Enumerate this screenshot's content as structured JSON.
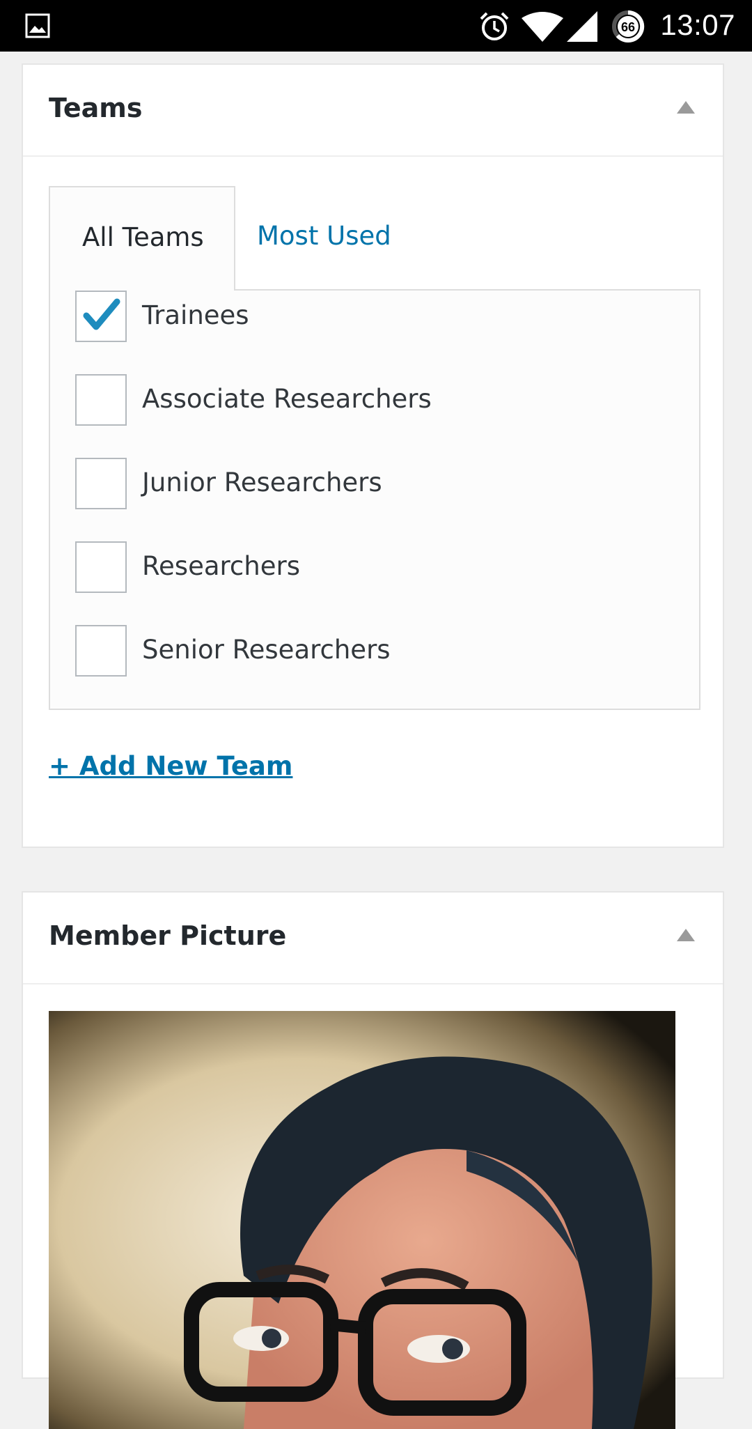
{
  "status_bar": {
    "time": "13:07",
    "battery_level": "66",
    "icons": [
      "gallery-icon",
      "alarm-icon",
      "wifi-icon",
      "signal-icon",
      "battery-icon"
    ]
  },
  "teams_panel": {
    "title": "Teams",
    "tabs": [
      {
        "label": "All Teams",
        "active": true
      },
      {
        "label": "Most Used",
        "active": false
      }
    ],
    "items": [
      {
        "label": "Trainees",
        "checked": true
      },
      {
        "label": "Associate Researchers",
        "checked": false
      },
      {
        "label": "Junior Researchers",
        "checked": false
      },
      {
        "label": "Researchers",
        "checked": false
      },
      {
        "label": "Senior Researchers",
        "checked": false
      }
    ],
    "add_new_label": "+ Add New Team"
  },
  "picture_panel": {
    "title": "Member Picture"
  },
  "colors": {
    "link": "#0073aa",
    "checkmark": "#1e8cbe",
    "page_background": "#f1f1f1"
  }
}
